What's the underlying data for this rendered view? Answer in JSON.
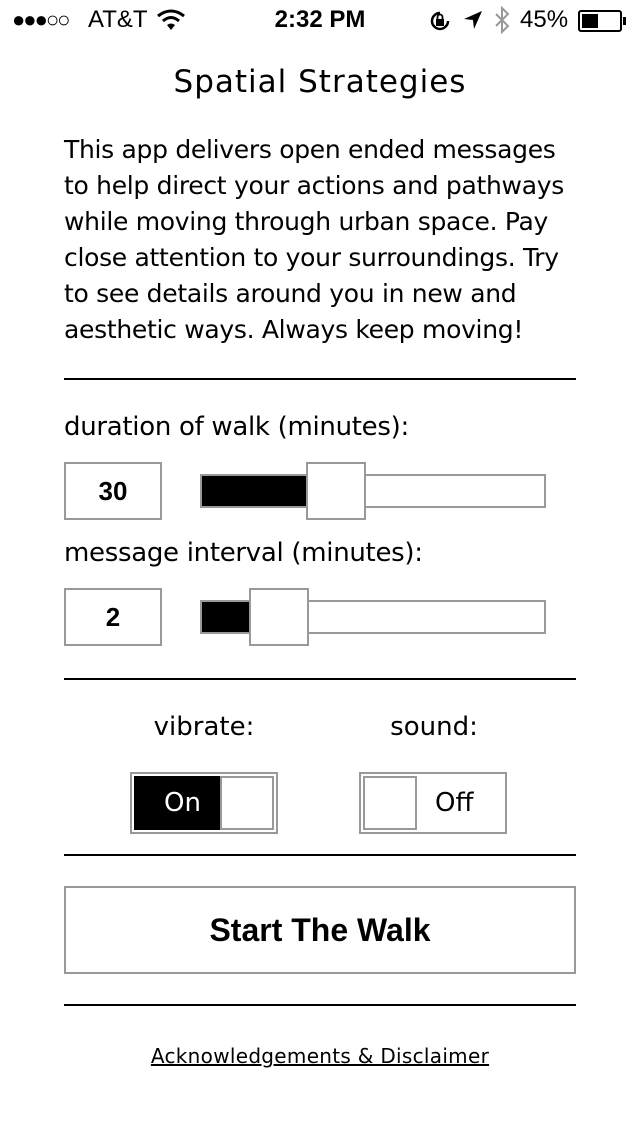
{
  "status_bar": {
    "signal": "●●●○○",
    "carrier": "AT&T",
    "time": "2:32 PM",
    "battery_percent": "45%",
    "battery_level": 0.45
  },
  "app": {
    "title": "Spatial Strategies",
    "intro": "This app delivers open ended messages to help direct your actions and pathways while moving through urban space. Pay close attention to your surroundings. Try to see details around you in new and aesthetic ways. Always keep moving!"
  },
  "duration": {
    "label": "duration of walk (minutes):",
    "value": "30",
    "slider_fraction": 0.37
  },
  "interval": {
    "label": "message interval (minutes):",
    "value": "2",
    "slider_fraction": 0.17
  },
  "vibrate": {
    "label": "vibrate:",
    "state": "On"
  },
  "sound": {
    "label": "sound:",
    "state": "Off"
  },
  "start_button": "Start The Walk",
  "footer_link": "Acknowledgements & Disclaimer"
}
